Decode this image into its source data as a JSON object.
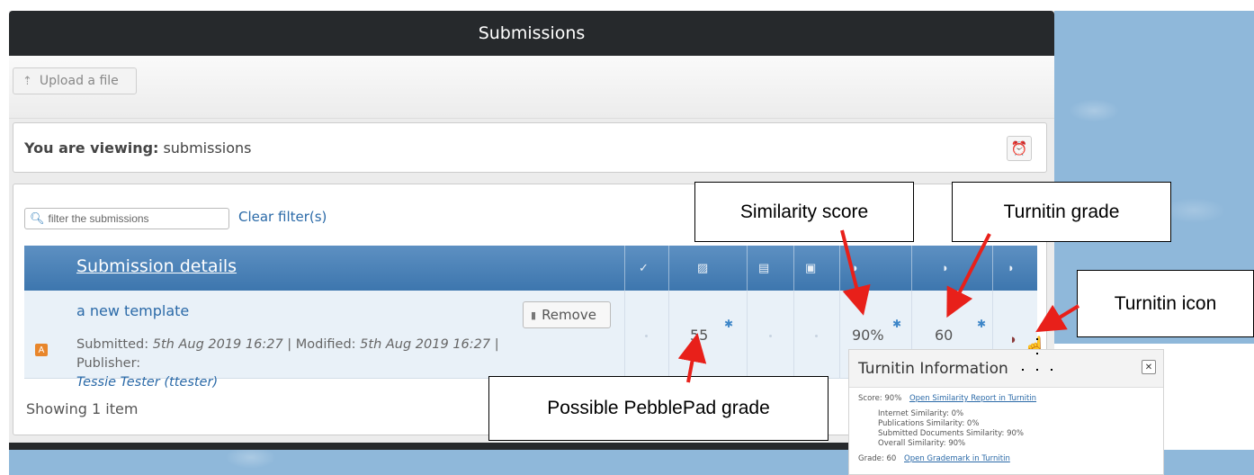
{
  "header": {
    "title": "Submissions"
  },
  "toolbar": {
    "upload_label": "Upload a file"
  },
  "viewing": {
    "prefix": "You are viewing:",
    "value": "submissions"
  },
  "filter": {
    "placeholder": "filter the submissions",
    "clear_label": "Clear filter(s)"
  },
  "table": {
    "header_title": "Submission details",
    "row": {
      "title": "a new template",
      "remove_label": "Remove",
      "submitted_label": "Submitted:",
      "submitted_date": "5th Aug 2019 16:27",
      "modified_label": "| Modified:",
      "modified_date": "5th Aug 2019 16:27",
      "publisher_label": "| Publisher:",
      "publisher": "Tessie Tester (ttester)",
      "pebblepad_grade": "55",
      "similarity": "90%",
      "turnitin_grade": "60"
    },
    "footer": "Showing 1 item"
  },
  "callouts": {
    "similarity_score": "Similarity score",
    "turnitin_grade": "Turnitin grade",
    "turnitin_icon": "Turnitin icon",
    "pebblepad_grade": "Possible PebblePad grade"
  },
  "turnitin_info": {
    "title": "Turnitin Information",
    "score_label": "Score: 90%",
    "similarity_link": "Open Similarity Report in Turnitin",
    "internet": "Internet Similarity: 0%",
    "publications": "Publications Similarity: 0%",
    "submitted_docs": "Submitted Documents Similarity: 90%",
    "overall": "Overall Similarity: 90%",
    "grade_label": "Grade: 60",
    "grademark_link": "Open Grademark in Turnitin"
  }
}
